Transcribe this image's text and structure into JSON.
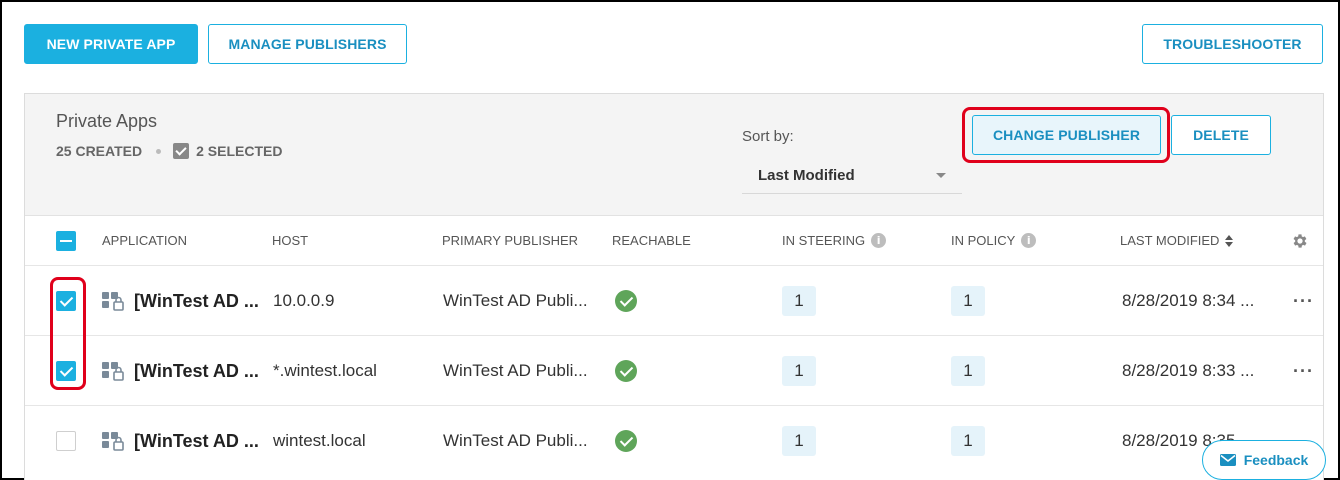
{
  "toolbar": {
    "new_private_app": "NEW PRIVATE APP",
    "manage_publishers": "MANAGE PUBLISHERS",
    "troubleshooter": "TROUBLESHOOTER"
  },
  "panel": {
    "title": "Private Apps",
    "created": "25 CREATED",
    "selected": "2 SELECTED",
    "sort_label": "Sort by:",
    "sort_value": "Last Modified",
    "change_publisher": "CHANGE PUBLISHER",
    "delete": "DELETE"
  },
  "columns": {
    "application": "APPLICATION",
    "host": "HOST",
    "primary_publisher": "PRIMARY PUBLISHER",
    "reachable": "REACHABLE",
    "in_steering": "IN STEERING",
    "in_policy": "IN POLICY",
    "last_modified": "LAST MODIFIED"
  },
  "rows": [
    {
      "selected": true,
      "application": "[WinTest AD ...",
      "host": "10.0.0.9",
      "publisher": "WinTest AD Publi...",
      "reachable": true,
      "in_steering": "1",
      "in_policy": "1",
      "last_modified": "8/28/2019 8:34 ..."
    },
    {
      "selected": true,
      "application": "[WinTest AD ...",
      "host": "*.wintest.local",
      "publisher": "WinTest AD Publi...",
      "reachable": true,
      "in_steering": "1",
      "in_policy": "1",
      "last_modified": "8/28/2019 8:33 ..."
    },
    {
      "selected": false,
      "application": "[WinTest AD ...",
      "host": "wintest.local",
      "publisher": "WinTest AD Publi...",
      "reachable": true,
      "in_steering": "1",
      "in_policy": "1",
      "last_modified": "8/28/2019 8:35 ..."
    }
  ],
  "feedback": "Feedback",
  "colors": {
    "accent": "#1bb0e0",
    "highlight": "#e0001b",
    "ok": "#5fa55a"
  },
  "icons": {
    "info": "i",
    "more": "···"
  }
}
